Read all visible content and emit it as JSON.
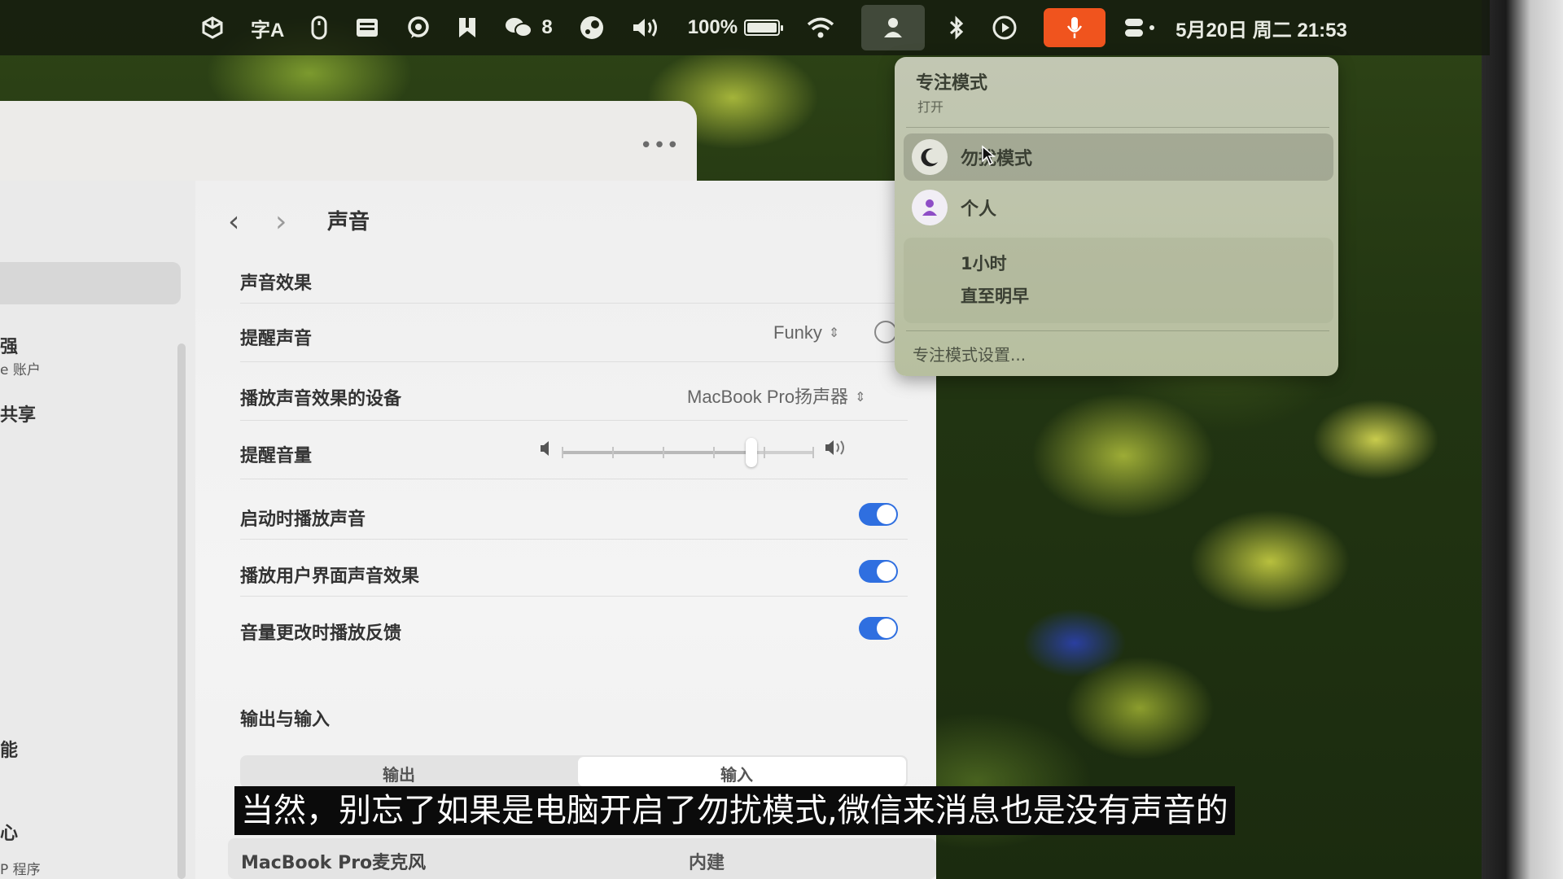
{
  "menubar": {
    "wechat_badge": "8",
    "battery_text": "100%",
    "datetime": "5月20日 周二 21:53"
  },
  "focus_menu": {
    "title": "专注模式",
    "status": "打开",
    "items": [
      {
        "label": "勿扰模式",
        "icon": "moon-icon"
      },
      {
        "label": "个人",
        "icon": "person-icon"
      }
    ],
    "durations": [
      "1小时",
      "直至明早"
    ],
    "settings_label": "专注模式设置..."
  },
  "window": {
    "more_label": "•••",
    "sidebar_fragments": [
      "强",
      "e 账户",
      "共享",
      "能",
      "心",
      "P 程序"
    ],
    "title": "声音",
    "section_effects": "声音效果",
    "alert_sound_label": "提醒声音",
    "alert_sound_value": "Funky",
    "device_label": "播放声音效果的设备",
    "device_value": "MacBook Pro扬声器",
    "alert_volume_label": "提醒音量",
    "alert_volume_level": 0.75,
    "toggles": [
      {
        "label": "启动时播放声音",
        "on": true
      },
      {
        "label": "播放用户界面声音效果",
        "on": true
      },
      {
        "label": "音量更改时播放反馈",
        "on": true
      }
    ],
    "section_io": "输出与输入",
    "tab_output": "输出",
    "tab_input": "输入",
    "mic_name": "MacBook Pro麦克风",
    "mic_type": "内建"
  },
  "subtitle": "当然，别忘了如果是电脑开启了勿扰模式,微信来消息也是没有声音的",
  "colors": {
    "accent": "#2f6fe0",
    "mic_active": "#f0541e"
  }
}
